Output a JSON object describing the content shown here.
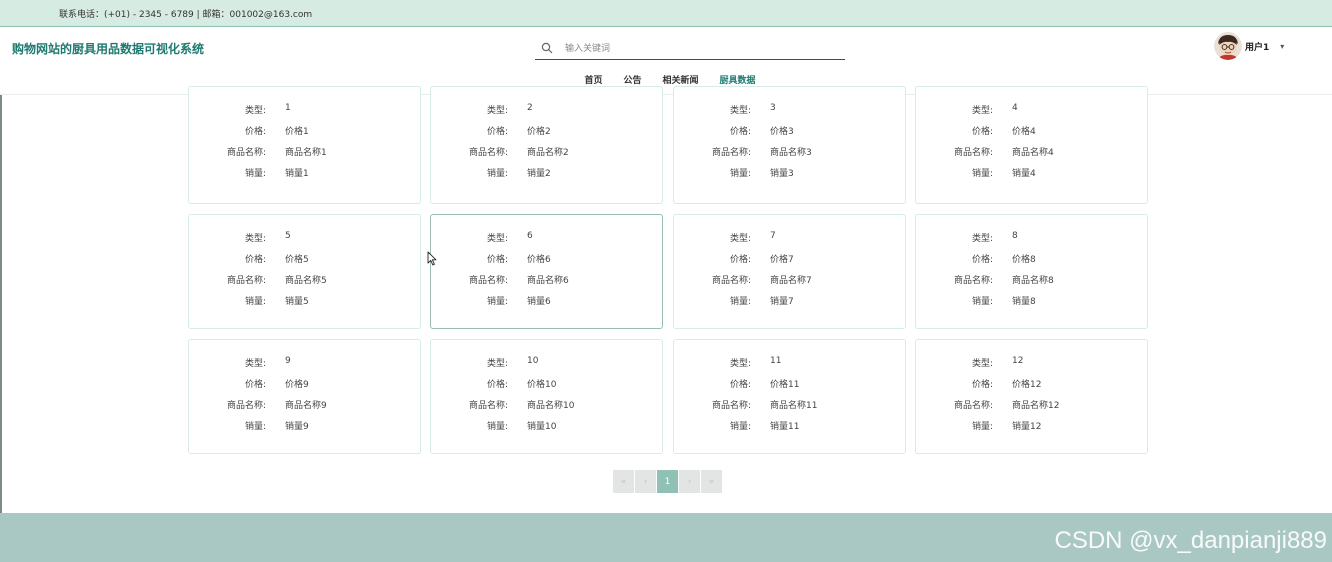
{
  "topbar": {
    "contact": "联系电话：(+01) - 2345 - 6789 | 邮箱：001002@163.com"
  },
  "header": {
    "site_title": "购物网站的厨具用品数据可视化系统"
  },
  "search": {
    "placeholder": "输入关键词",
    "icon": "search-icon"
  },
  "nav": {
    "items": [
      "首页",
      "公告",
      "相关新闻",
      "厨具数据"
    ],
    "active": "厨具数据"
  },
  "user": {
    "name": "用户1",
    "avatar_icon": "avatar"
  },
  "fields": {
    "type": "类型:",
    "price": "价格:",
    "name": "商品名称:",
    "sales": "销量:"
  },
  "cards": [
    {
      "type": "1",
      "price": "价格1",
      "name": "商品名称1",
      "sales": "销量1"
    },
    {
      "type": "2",
      "price": "价格2",
      "name": "商品名称2",
      "sales": "销量2"
    },
    {
      "type": "3",
      "price": "价格3",
      "name": "商品名称3",
      "sales": "销量3"
    },
    {
      "type": "4",
      "price": "价格4",
      "name": "商品名称4",
      "sales": "销量4"
    },
    {
      "type": "5",
      "price": "价格5",
      "name": "商品名称5",
      "sales": "销量5"
    },
    {
      "type": "6",
      "price": "价格6",
      "name": "商品名称6",
      "sales": "销量6"
    },
    {
      "type": "7",
      "price": "价格7",
      "name": "商品名称7",
      "sales": "销量7"
    },
    {
      "type": "8",
      "price": "价格8",
      "name": "商品名称8",
      "sales": "销量8"
    },
    {
      "type": "9",
      "price": "价格9",
      "name": "商品名称9",
      "sales": "销量9"
    },
    {
      "type": "10",
      "price": "价格10",
      "name": "商品名称10",
      "sales": "销量10"
    },
    {
      "type": "11",
      "price": "价格11",
      "name": "商品名称11",
      "sales": "销量11"
    },
    {
      "type": "12",
      "price": "价格12",
      "name": "商品名称12",
      "sales": "销量12"
    }
  ],
  "pagination": {
    "first": "«",
    "prev": "‹",
    "current": "1",
    "next": "›",
    "last": "»"
  },
  "watermark": "CSDN @vx_danpianji889",
  "colors": {
    "accent": "#1f7a70",
    "topbar": "#d6ebe2",
    "footer": "#a9c8c3",
    "page_active": "#8fc2b5"
  }
}
